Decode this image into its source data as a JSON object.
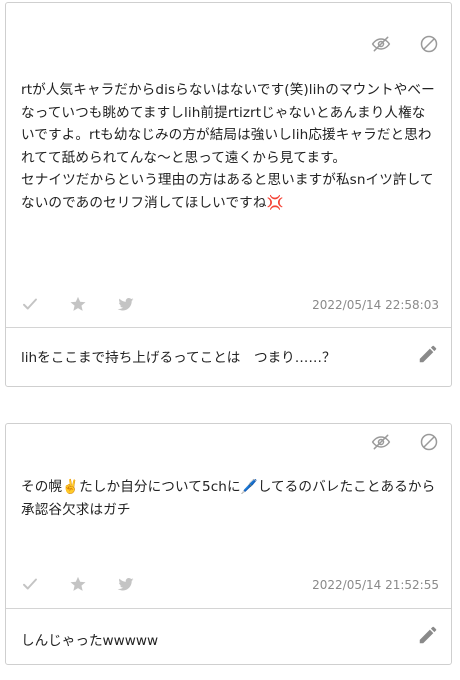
{
  "posts": [
    {
      "body": "rtが人気キャラだからdisらないはないです(笑)lihのマウントやべーなっていつも眺めてますしlih前提rtizrtじゃないとあんまり人権ないですよ。rtも幼なじみの方が結局は強いしlih応援キャラだと思われてて舐められてんな〜と思って遠くから見てます。\nセナイツだからという理由の方はあると思いますが私snイツ許してないのであのセリフ消してほしいですね💢",
      "timestamp": "2022/05/14 22:58:03",
      "reply": "lihをここまで持ち上げるってことは　つまり……？"
    },
    {
      "body": "その幌✌️たしか自分について5chに🖊️してるのバレたことあるから承認谷欠求はガチ",
      "timestamp": "2022/05/14 21:52:55",
      "reply": "しんじゃったwwwww"
    }
  ],
  "icons": {
    "hide": "eye-slash-icon",
    "block": "block-icon",
    "like": "check-icon",
    "favorite": "star-icon",
    "share": "twitter-icon",
    "edit": "pencil-icon"
  },
  "colors": {
    "icon": "#bcbcbc",
    "icon_dark": "#9a9a9a",
    "text": "#222222",
    "timestamp": "#8a8a8a",
    "border": "#cfcfcf"
  }
}
